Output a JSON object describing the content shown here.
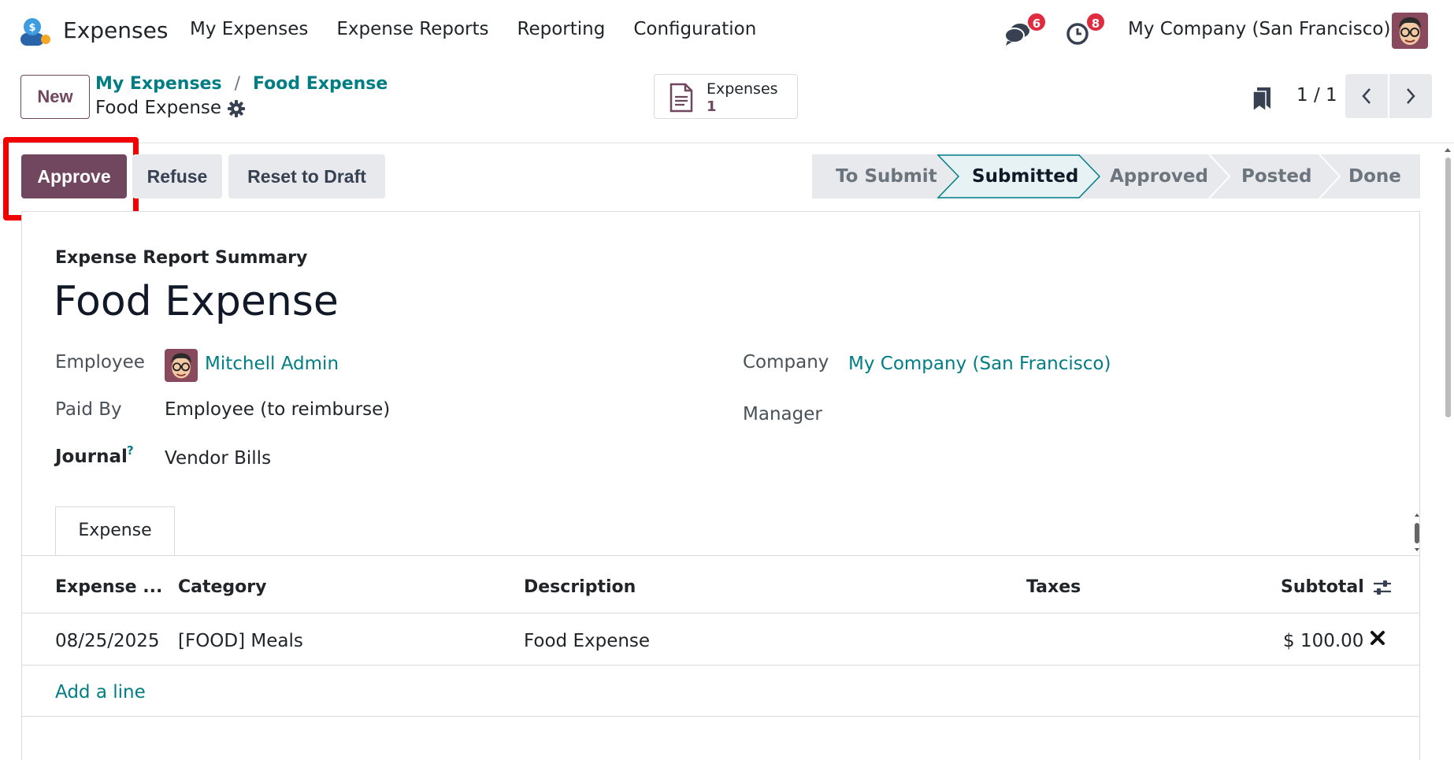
{
  "navbar": {
    "app_name": "Expenses",
    "menu": [
      "My Expenses",
      "Expense Reports",
      "Reporting",
      "Configuration"
    ],
    "chat_count": "6",
    "activity_count": "8",
    "company": "My Company (San Francisco)"
  },
  "control_panel": {
    "new_label": "New",
    "breadcrumb": [
      "My Expenses",
      "Food Expense"
    ],
    "breadcrumb_sep": "/",
    "record_title": "Food Expense",
    "smart_button": {
      "label": "Expenses",
      "value": "1"
    },
    "pager": "1 / 1"
  },
  "statusbar": {
    "approve_label": "Approve",
    "refuse_label": "Refuse",
    "reset_label": "Reset to Draft",
    "stages": [
      "To Submit",
      "Submitted",
      "Approved",
      "Posted",
      "Done"
    ],
    "current_stage": "Submitted"
  },
  "form": {
    "subtitle": "Expense Report Summary",
    "title": "Food Expense",
    "employee_label": "Employee",
    "employee_value": "Mitchell Admin",
    "paid_by_label": "Paid By",
    "paid_by_value": "Employee (to reimburse)",
    "journal_label": "Journal",
    "journal_help": "?",
    "journal_value": "Vendor Bills",
    "company_label": "Company",
    "company_value": "My Company (San Francisco)",
    "manager_label": "Manager"
  },
  "tabs": [
    "Expense"
  ],
  "table": {
    "columns": [
      "Expense ...",
      "Category",
      "Description",
      "Taxes",
      "Subtotal"
    ],
    "rows": [
      {
        "date": "08/25/2025",
        "category": "[FOOD] Meals",
        "description": "Food Expense",
        "taxes": "",
        "subtotal": "$ 100.00"
      }
    ],
    "add_line": "Add a line"
  },
  "colors": {
    "primary": "#71465f",
    "link": "#017e84",
    "badge": "#e02a3f",
    "highlight": "#f20000",
    "current_stage_bg": "#e6f2f3"
  }
}
